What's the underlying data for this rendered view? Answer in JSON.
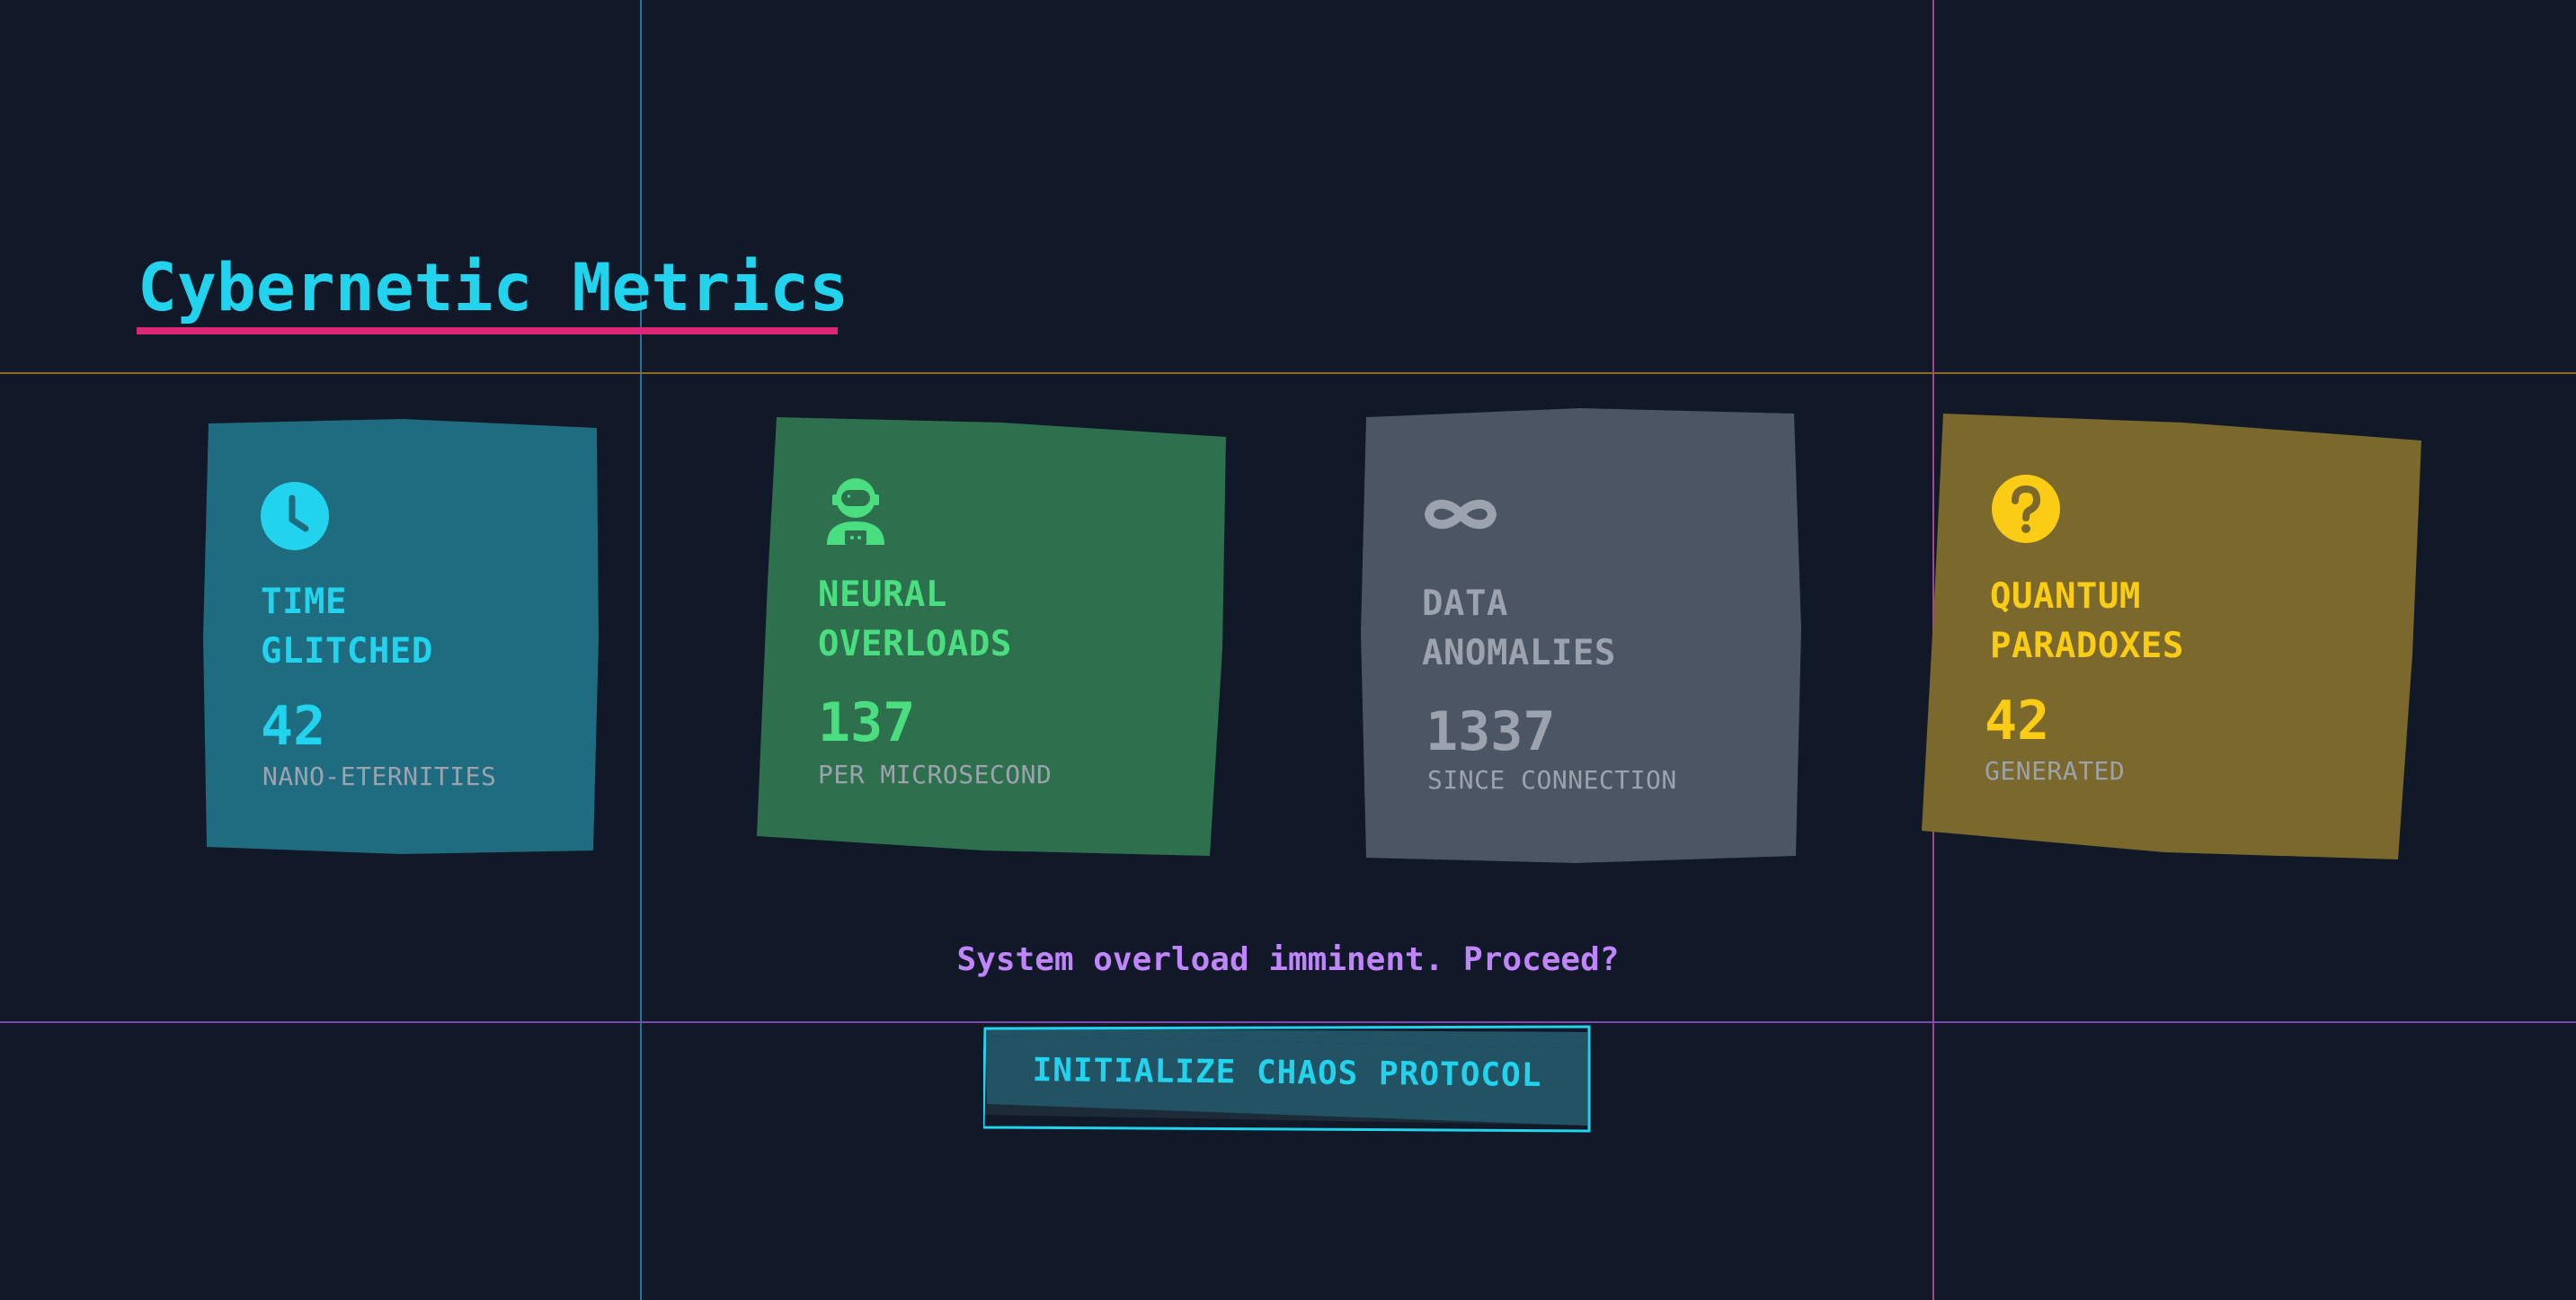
{
  "page": {
    "title": "Cybernetic Metrics",
    "prompt": "System overload imminent. Proceed?",
    "action_label": "INITIALIZE CHAOS PROTOCOL"
  },
  "colors": {
    "background": "#111827",
    "title": "#22d3ee",
    "title_underline": "#db2777",
    "prompt": "#c084fc",
    "button_border": "#22d3ee"
  },
  "cards": [
    {
      "icon": "clock-icon",
      "label_line1": "TIME",
      "label_line2": "GLITCHED",
      "value": "42",
      "unit": "NANO-ETERNITIES",
      "accent": "#22d3ee",
      "background": "#1f6b80"
    },
    {
      "icon": "astronaut-icon",
      "label_line1": "NEURAL",
      "label_line2": "OVERLOADS",
      "value": "137",
      "unit": "PER MICROSECOND",
      "accent": "#4ade80",
      "background": "#2e6f4e"
    },
    {
      "icon": "infinity-icon",
      "label_line1": "DATA",
      "label_line2": "ANOMALIES",
      "value": "1337",
      "unit": "SINCE CONNECTION",
      "accent": "#9ca3af",
      "background": "#4b5563"
    },
    {
      "icon": "question-circle-icon",
      "label_line1": "QUANTUM",
      "label_line2": "PARADOXES",
      "value": "42",
      "unit": "GENERATED",
      "accent": "#facc15",
      "background": "#7a682c"
    }
  ]
}
